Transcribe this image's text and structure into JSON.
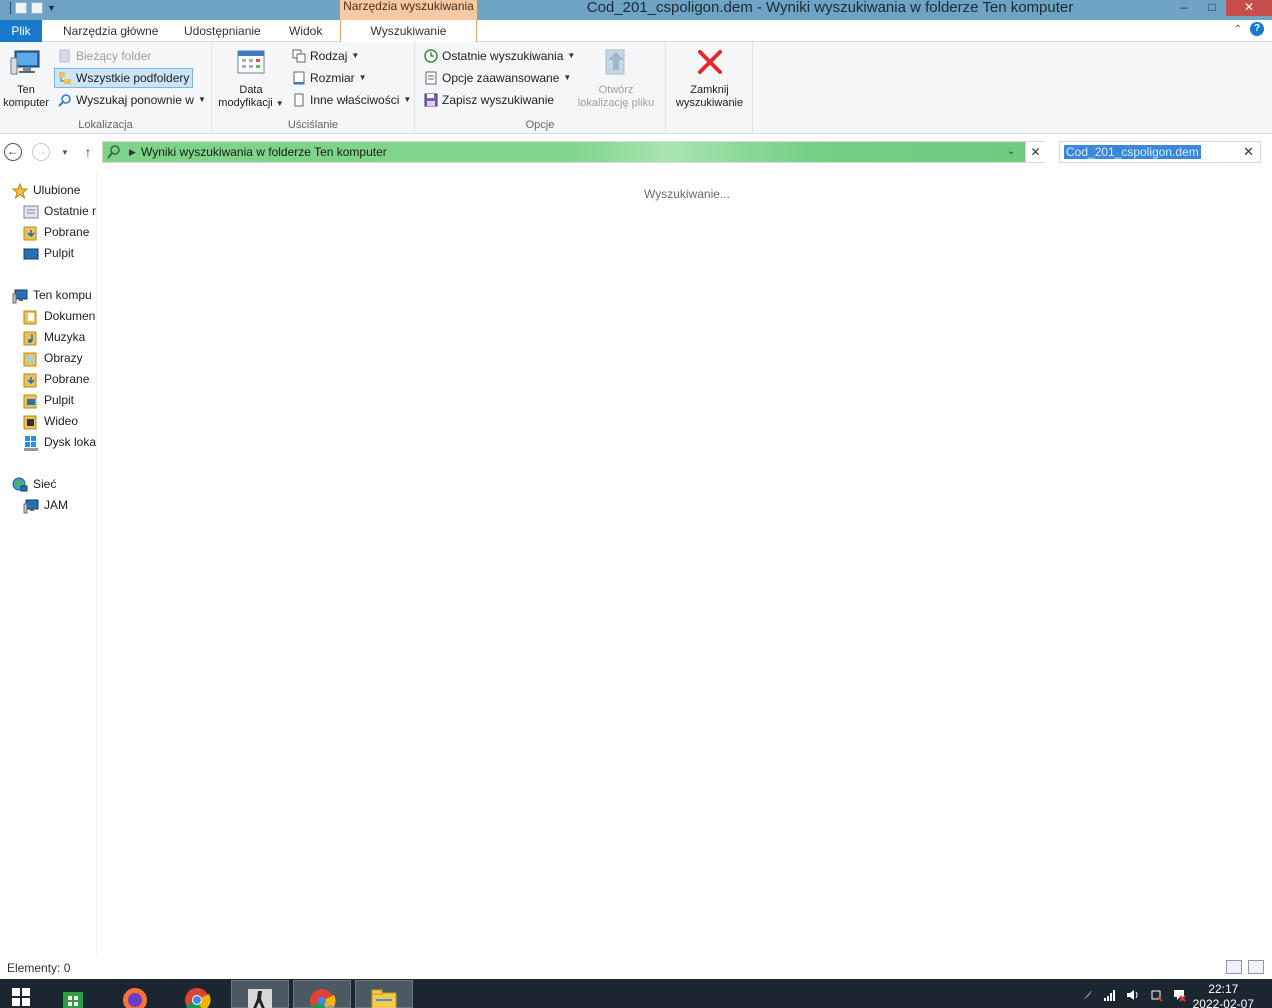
{
  "window": {
    "title": "Cod_201_cspoligon.dem - Wyniki wyszukiwania w folderze Ten komputer",
    "context_tab_header": "Narzędzia wyszukiwania",
    "minimize": "–",
    "maximize": "□",
    "close": "✕"
  },
  "tabs": {
    "file": "Plik",
    "home": "Narzędzia główne",
    "share": "Udostępnianie",
    "view": "Widok",
    "search": "Wyszukiwanie"
  },
  "ribbon": {
    "location": {
      "label": "Lokalizacja",
      "this_pc_line1": "Ten",
      "this_pc_line2": "komputer",
      "current_folder": "Bieżący folder",
      "all_subfolders": "Wszystkie podfoldery",
      "search_again": "Wyszukaj ponownie w"
    },
    "refine": {
      "label": "Uściślanie",
      "date_line1": "Data",
      "date_line2": "modyfikacji",
      "kind": "Rodzaj",
      "size": "Rozmiar",
      "other_props": "Inne właściwości"
    },
    "options": {
      "label": "Opcje",
      "recent_searches": "Ostatnie wyszukiwania",
      "advanced_options": "Opcje zaawansowane",
      "save_search": "Zapisz wyszukiwanie",
      "open_location_line1": "Otwórz",
      "open_location_line2": "lokalizację pliku"
    },
    "close": {
      "line1": "Zamknij",
      "line2": "wyszukiwanie"
    }
  },
  "address": {
    "path": "Wyniki wyszukiwania w folderze Ten komputer",
    "search_value": "Cod_201_cspoligon.dem"
  },
  "nav": {
    "favorites": "Ulubione",
    "recent": "Ostatnie r",
    "downloads_fav": "Pobrane",
    "desktop_fav": "Pulpit",
    "this_pc": "Ten kompu",
    "documents": "Dokumen",
    "music": "Muzyka",
    "pictures": "Obrazy",
    "downloads": "Pobrane",
    "desktop": "Pulpit",
    "videos": "Wideo",
    "local_disk": "Dysk loka",
    "network": "Sieć",
    "network_pc": "JAM"
  },
  "content": {
    "status_message": "Wyszukiwanie..."
  },
  "statusbar": {
    "items": "Elementy: 0"
  },
  "taskbar": {
    "time": "22:17",
    "date": "2022-02-07"
  },
  "colors": {
    "accent": "#1979ca",
    "titlebar": "#6fa3c4",
    "context_tab": "#f6c8a3",
    "progress_green": "#7dd489",
    "taskbar": "#1b2631"
  }
}
